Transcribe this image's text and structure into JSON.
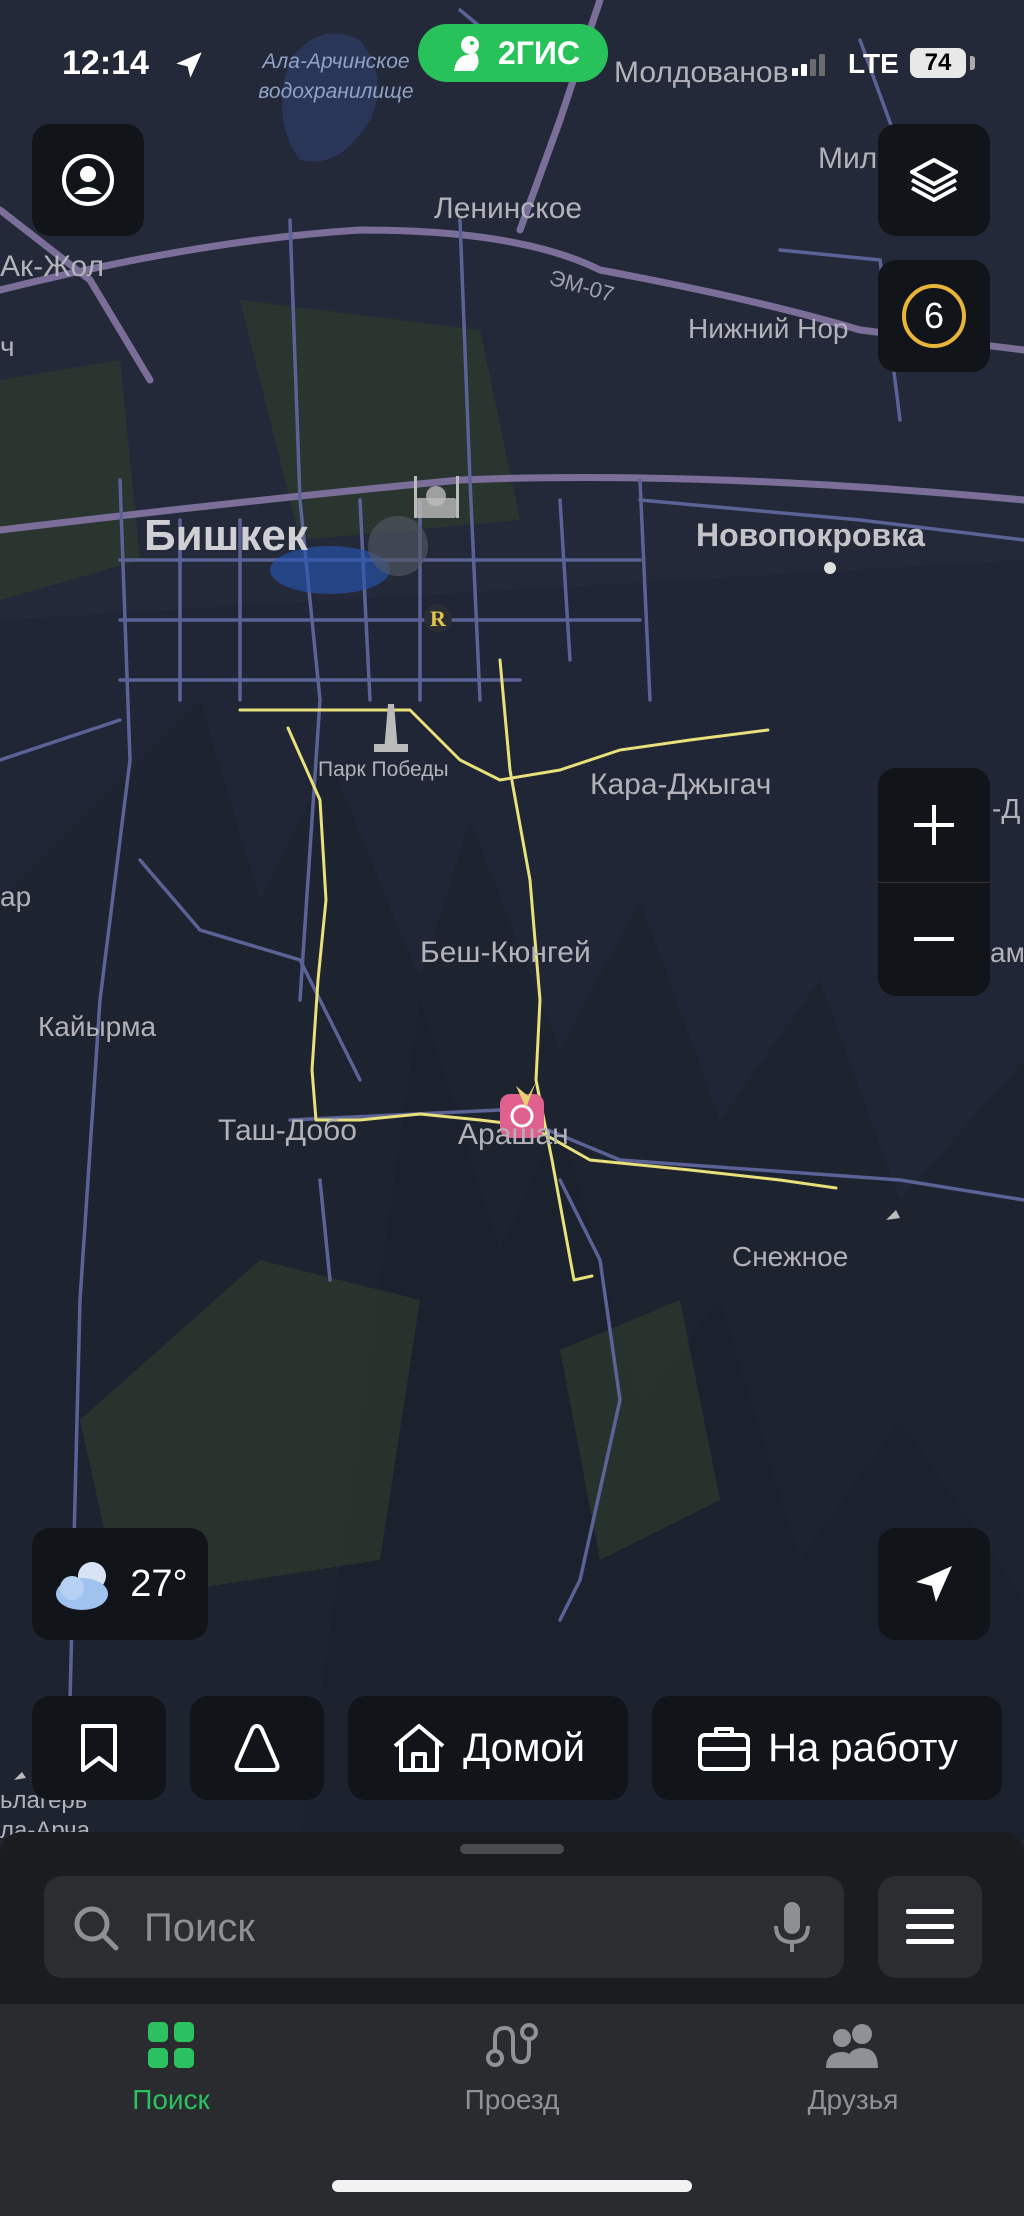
{
  "status_bar": {
    "time": "12:14",
    "network": "LTE",
    "battery": "74"
  },
  "brand": {
    "name": "2ГИС"
  },
  "map": {
    "labels": {
      "reservoir": [
        "Ала-Арчинское",
        "водохранилище"
      ],
      "moldovanovka": "Молдованов",
      "mil": "Мил",
      "leninskoe": "Ленинское",
      "ak_zhol": "Ак-Жол",
      "road_em07": "ЭМ-07",
      "nizhniy": "Нижний Нор",
      "ch": "ч",
      "bishkek": "Бишкек",
      "novopokrovka": "Новопокровка",
      "park": "Парк Победы",
      "kara_dzhygach": "Кара-Джыгач",
      "ar": "ар",
      "besh_kungey": "Беш-Кюнгей",
      "kayyrma": "Кайырма",
      "tash_dobo": "Таш-Добо",
      "arashan": "Арашан",
      "snezhnoe": "Снежное",
      "edge_right_1": "-Д",
      "edge_right_2": "ам",
      "bottom_left_1": "ьлагерь",
      "bottom_left_2": "ла-Арча"
    },
    "traffic_score": "6",
    "weather": {
      "temp": "27°",
      "icon": "partly-cloudy-icon"
    }
  },
  "quick_actions": {
    "home": "Домой",
    "work": "На работу"
  },
  "search": {
    "placeholder": "Поиск"
  },
  "tabs": [
    {
      "label": "Поиск",
      "active": true
    },
    {
      "label": "Проезд",
      "active": false
    },
    {
      "label": "Друзья",
      "active": false
    }
  ],
  "colors": {
    "accent": "#27c25a",
    "route": "#e8e07a",
    "map_bg": "#232938",
    "road": "#6f78a8"
  }
}
